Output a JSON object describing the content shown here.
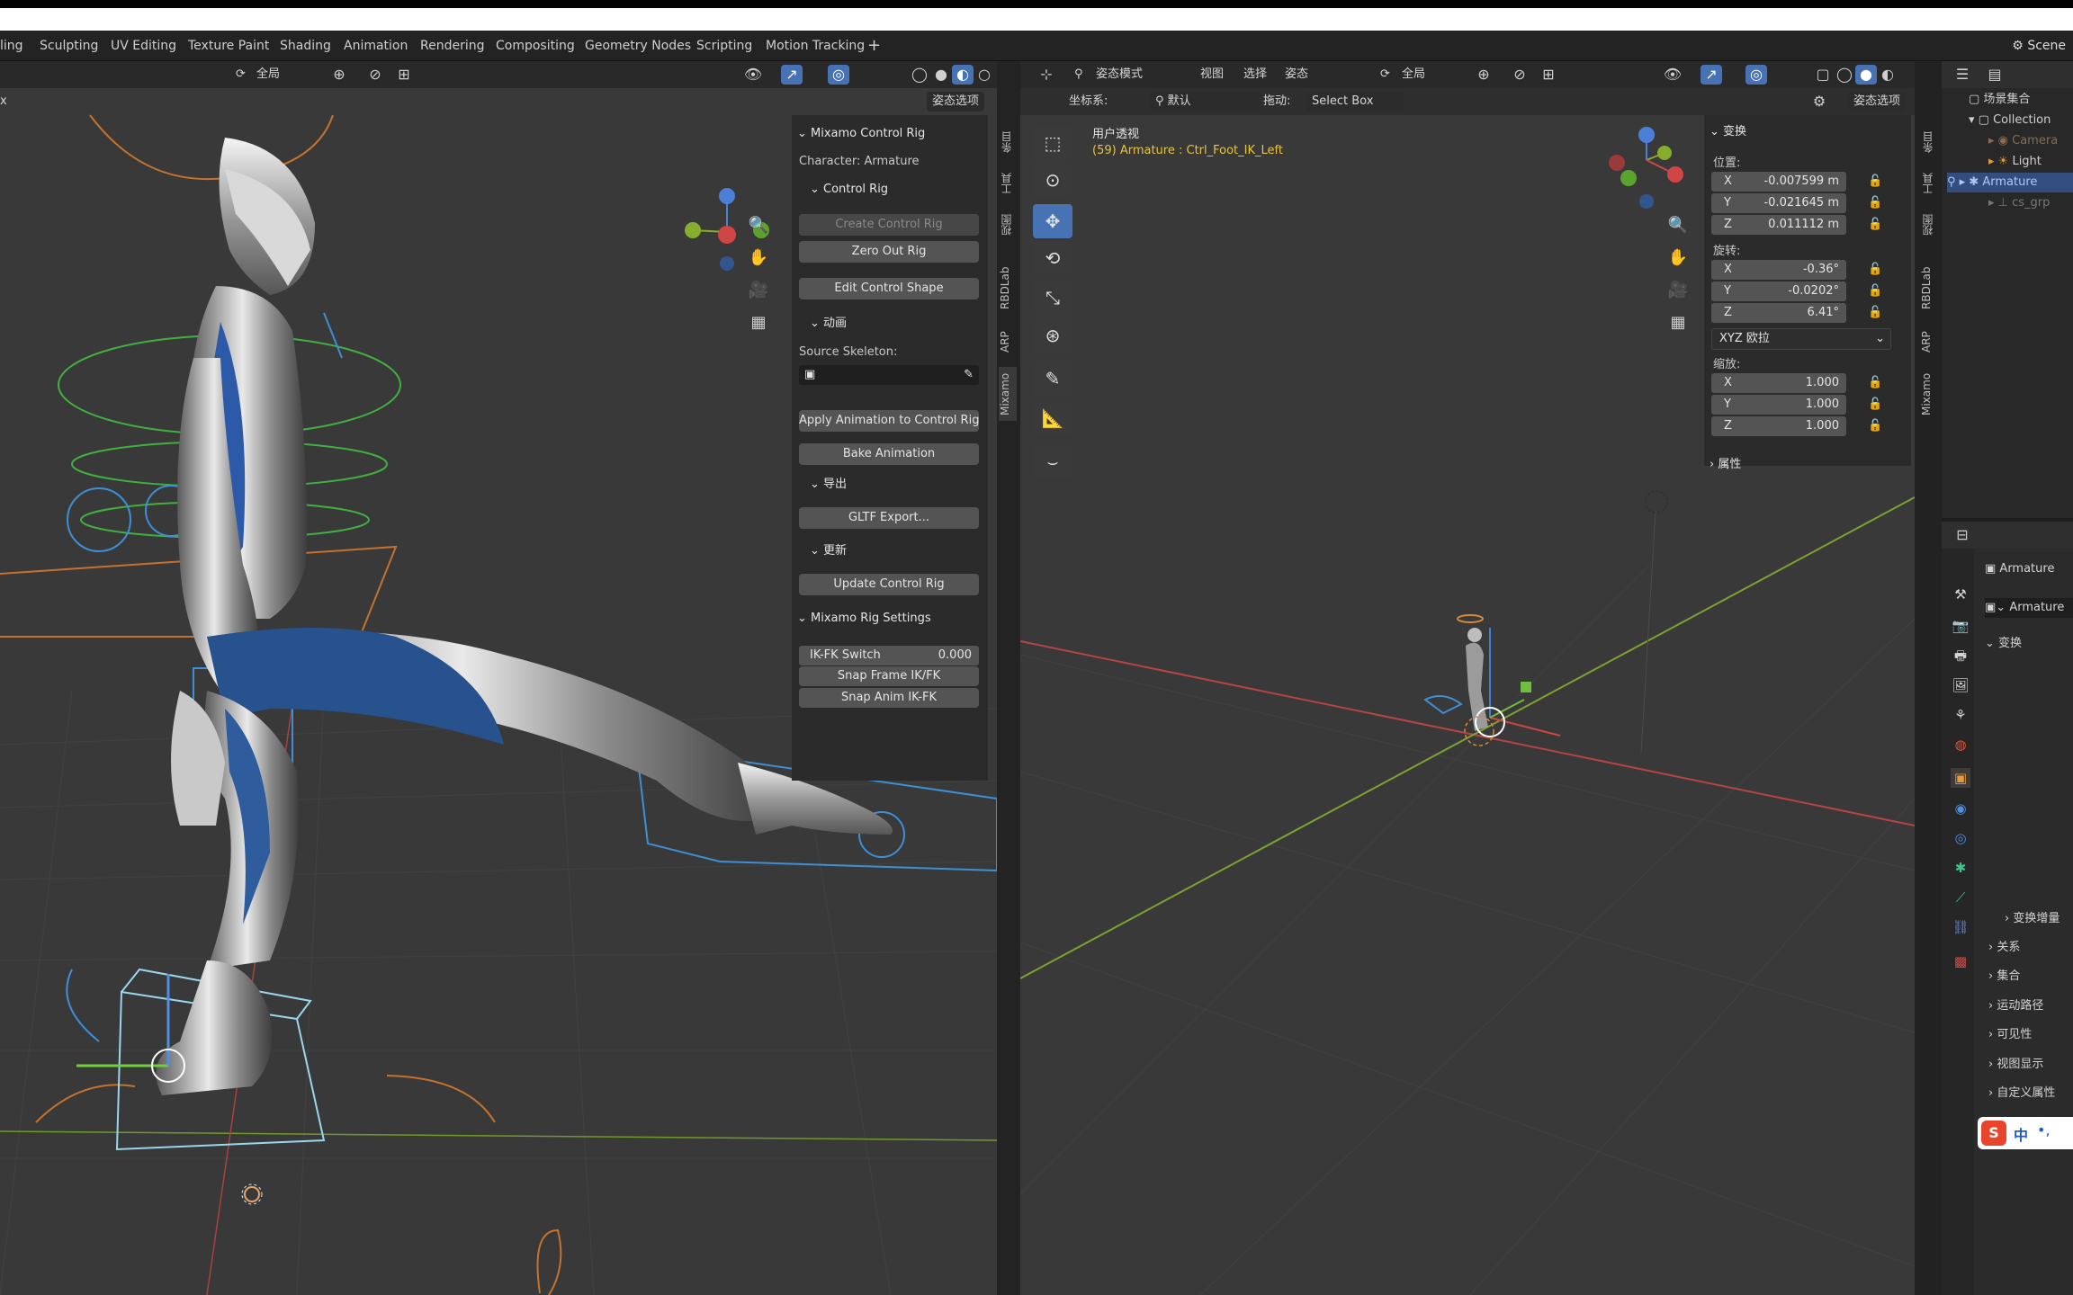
{
  "workspaces": [
    "ling",
    "Sculpting",
    "UV Editing",
    "Texture Paint",
    "Shading",
    "Animation",
    "Rendering",
    "Compositing",
    "Geometry Nodes",
    "Scripting",
    "Motion Tracking",
    "+"
  ],
  "scene_label": "Scene",
  "left_viewport": {
    "header": {
      "orientation": "全局",
      "left_cut": "x"
    },
    "pose_options": "姿态选项",
    "npanel": {
      "title": "Mixamo Control Rig",
      "character": "Character: Armature",
      "control_rig_section": "Control Rig",
      "create_control_rig": "Create Control Rig",
      "zero_out_rig": "Zero Out Rig",
      "edit_control_shape": "Edit Control Shape",
      "animation_section": "动画",
      "source_skeleton": "Source Skeleton:",
      "apply_animation": "Apply Animation to Control Rig",
      "bake_animation": "Bake Animation",
      "export_section": "导出",
      "gltf_export": "GLTF Export...",
      "update_section": "更新",
      "update_control_rig": "Update Control Rig",
      "rig_settings_title": "Mixamo Rig Settings",
      "ikfk_label": "IK-FK Switch",
      "ikfk_value": "0.000",
      "snap_frame": "Snap Frame IK/FK",
      "snap_anim": "Snap Anim IK-FK"
    },
    "side_tabs": [
      "条目",
      "工具",
      "视图",
      "RBDLab",
      "ARP",
      "Mixamo"
    ]
  },
  "right_viewport": {
    "header": {
      "mode": "姿态模式",
      "menu_view": "视图",
      "menu_select": "选择",
      "menu_pose": "姿态",
      "orientation": "全局"
    },
    "header2": {
      "coord_label": "坐标系:",
      "coord_value": "默认",
      "drag_label": "拖动:",
      "drag_value": "Select Box"
    },
    "pose_options": "姿态选项",
    "view_label": "用户透视",
    "active_info": "(59) Armature : Ctrl_Foot_IK_Left",
    "transform": {
      "title": "变换",
      "location_label": "位置:",
      "location": [
        {
          "axis": "X",
          "value": "-0.007599 m"
        },
        {
          "axis": "Y",
          "value": "-0.021645 m"
        },
        {
          "axis": "Z",
          "value": "0.011112 m"
        }
      ],
      "rotation_label": "旋转:",
      "rotation": [
        {
          "axis": "X",
          "value": "-0.36°"
        },
        {
          "axis": "Y",
          "value": "-0.0202°"
        },
        {
          "axis": "Z",
          "value": "6.41°"
        }
      ],
      "rotation_mode": "XYZ 欧拉",
      "scale_label": "缩放:",
      "scale": [
        {
          "axis": "X",
          "value": "1.000"
        },
        {
          "axis": "Y",
          "value": "1.000"
        },
        {
          "axis": "Z",
          "value": "1.000"
        }
      ],
      "properties": "属性"
    },
    "side_tabs": [
      "条目",
      "工具",
      "视图",
      "RBDLab",
      "ARP",
      "Mixamo"
    ]
  },
  "outliner": {
    "scene_collection": "场景集合",
    "items": [
      {
        "name": "Collection"
      },
      {
        "name": "Camera"
      },
      {
        "name": "Light"
      },
      {
        "name": "Armature"
      },
      {
        "name": "cs_grp"
      }
    ]
  },
  "properties": {
    "object_name": "Armature",
    "data_name": "Armature",
    "transform_section": "变换",
    "delta_transform": "变换增量",
    "sections": [
      "关系",
      "集合",
      "运动路径",
      "可见性",
      "视图显示",
      "自定义属性"
    ]
  },
  "ime": {
    "label": "中"
  },
  "colors": {
    "accent": "#4772b3",
    "axis_x": "#c84646",
    "axis_y": "#7fa52a",
    "info_text": "#e8c53a"
  }
}
